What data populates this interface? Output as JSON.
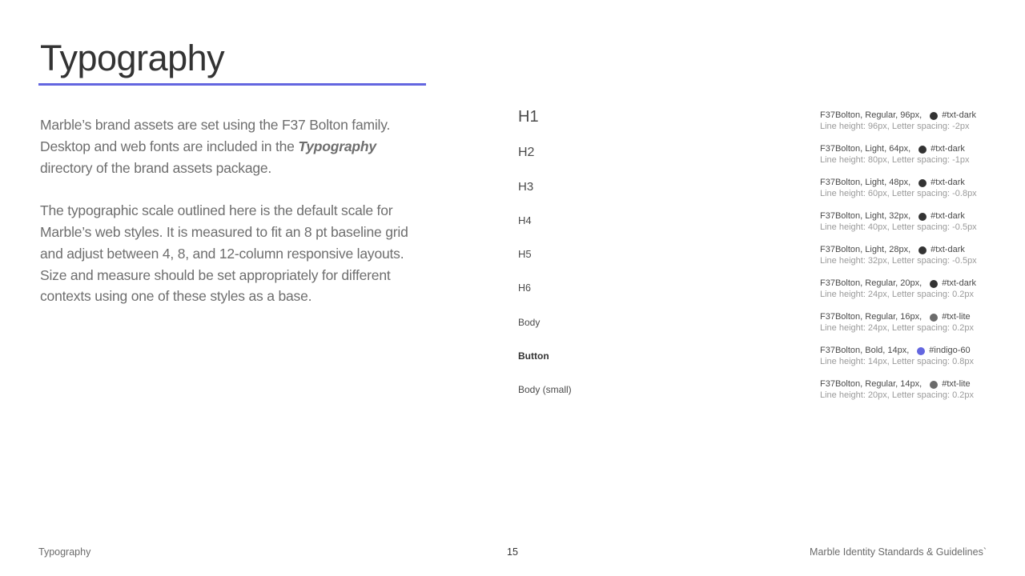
{
  "page": {
    "title": "Typography",
    "intro_p1_a": "Marble’s brand assets are set using the F37 Bolton family. Desktop and web fonts are included in the ",
    "intro_p1_em": "Typography",
    "intro_p1_b": " directory of the brand assets package.",
    "intro_p2": "The typographic scale outlined here is the default scale for Marble’s web styles. It is measured to fit an 8 pt baseline grid and adjust between 4, 8, and 12-column responsive layouts. Size and measure should be set appropriately for different contexts using one of these styles as a base."
  },
  "scale": [
    {
      "name": "H1",
      "spec": "F37Bolton, Regular, 96px,",
      "color_name": "#txt-dark",
      "color": "#333333",
      "metrics": "Line height: 96px, Letter spacing: -2px"
    },
    {
      "name": "H2",
      "spec": "F37Bolton, Light, 64px,",
      "color_name": "#txt-dark",
      "color": "#333333",
      "metrics": "Line height: 80px, Letter spacing: -1px"
    },
    {
      "name": "H3",
      "spec": "F37Bolton, Light, 48px,",
      "color_name": "#txt-dark",
      "color": "#333333",
      "metrics": "Line height: 60px, Letter spacing: -0.8px"
    },
    {
      "name": "H4",
      "spec": "F37Bolton, Light, 32px,",
      "color_name": "#txt-dark",
      "color": "#333333",
      "metrics": "Line height: 40px, Letter spacing: -0.5px"
    },
    {
      "name": "H5",
      "spec": "F37Bolton, Light, 28px,",
      "color_name": "#txt-dark",
      "color": "#333333",
      "metrics": "Line height: 32px, Letter spacing: -0.5px"
    },
    {
      "name": "H6",
      "spec": "F37Bolton, Regular, 20px,",
      "color_name": "#txt-dark",
      "color": "#333333",
      "metrics": "Line height: 24px, Letter spacing: 0.2px"
    },
    {
      "name": "Body",
      "spec": "F37Bolton, Regular, 16px,",
      "color_name": "#txt-lite",
      "color": "#6b6b6b",
      "metrics": "Line height: 24px, Letter spacing: 0.2px"
    },
    {
      "name": "Button",
      "spec": "F37Bolton, Bold, 14px,",
      "color_name": "#indigo-60",
      "color": "#6366e0",
      "metrics": "Line height: 14px, Letter spacing: 0.8px"
    },
    {
      "name": "Body (small)",
      "spec": "F37Bolton, Regular, 14px,",
      "color_name": "#txt-lite",
      "color": "#6b6b6b",
      "metrics": "Line height: 20px, Letter spacing: 0.2px"
    }
  ],
  "footer": {
    "left": "Typography",
    "page_number": "15",
    "right": "Marble Identity Standards & Guidelines`"
  }
}
